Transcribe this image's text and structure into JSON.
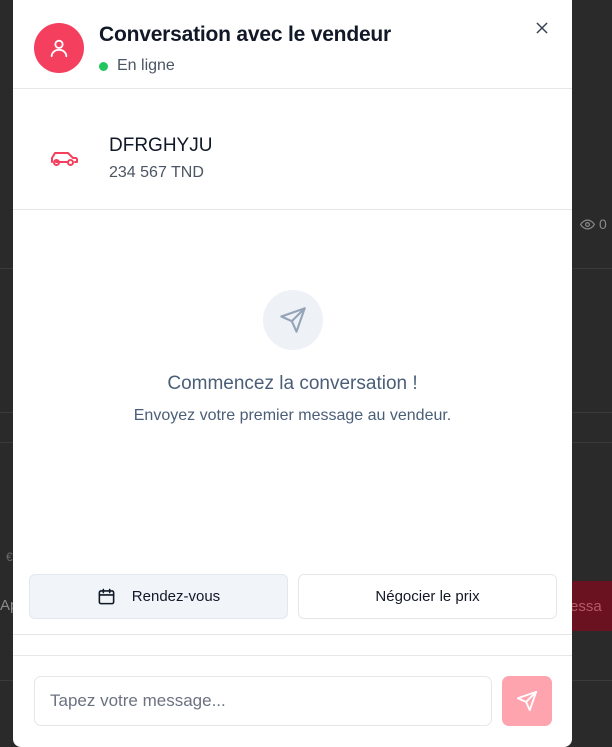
{
  "background": {
    "views_text": "0",
    "left_text": "Ap",
    "left_small": "€",
    "right_button_text": "essa"
  },
  "chat": {
    "title": "Conversation avec le vendeur",
    "status": "En ligne",
    "status_color": "#22c55e",
    "accent_color": "#f43f5e"
  },
  "product": {
    "name": "DFRGHYJU",
    "price": "234 567 TND",
    "icon": "car-icon"
  },
  "empty_state": {
    "title": "Commencez la conversation !",
    "subtitle": "Envoyez votre premier message au vendeur.",
    "icon": "send-icon"
  },
  "actions": {
    "appointment_label": "Rendez-vous",
    "negotiate_label": "Négocier le prix"
  },
  "composer": {
    "placeholder": "Tapez votre message...",
    "value": ""
  }
}
